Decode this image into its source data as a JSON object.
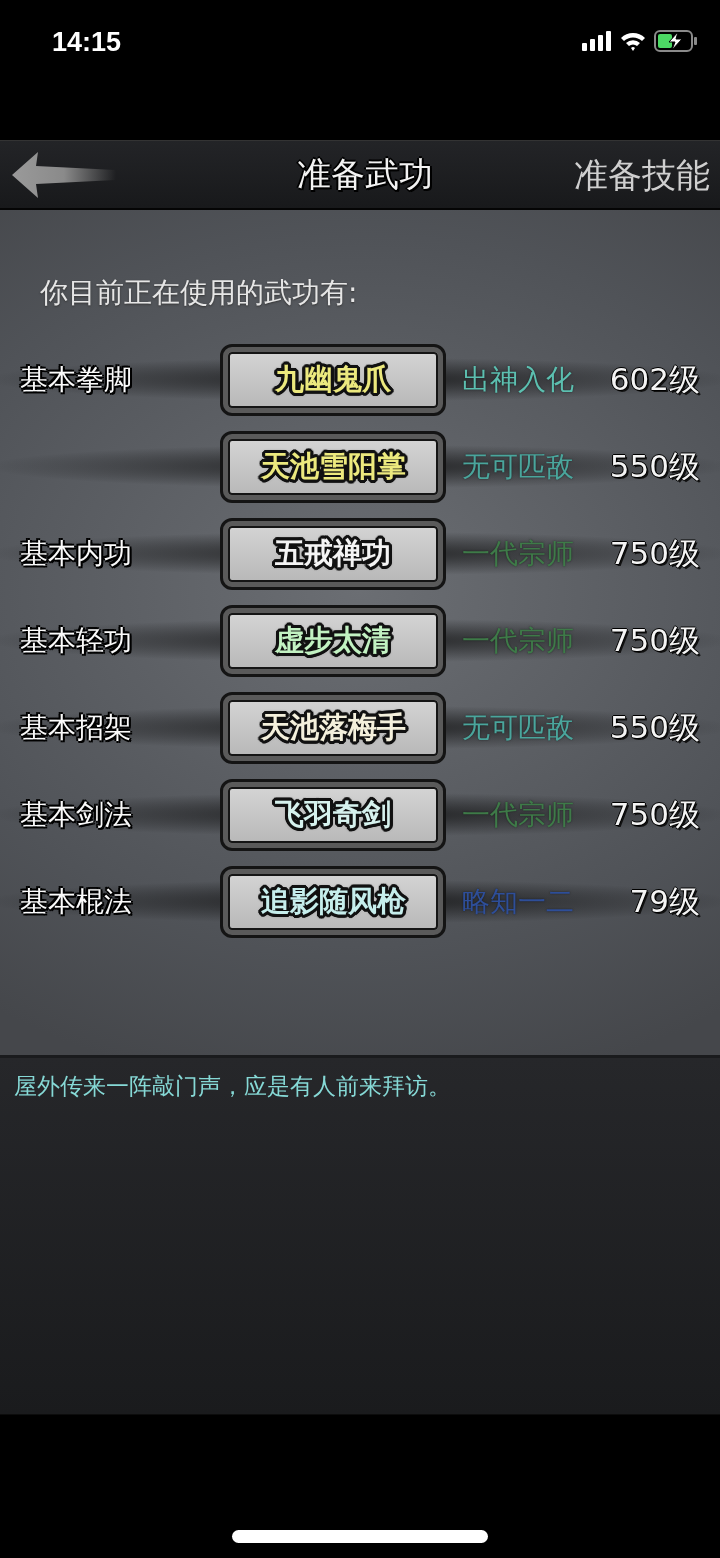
{
  "status_bar": {
    "time": "14:15"
  },
  "header": {
    "title": "准备武功",
    "switch_button": "准备技能"
  },
  "panel": {
    "heading": "你目前正在使用的武功有:",
    "rows": [
      {
        "category": "基本拳脚",
        "skill": {
          "name": "九幽鬼爪",
          "color": "#ece97e"
        },
        "rank": {
          "text": "出神入化",
          "color": "#5cbfb0"
        },
        "grade": "602级"
      },
      {
        "skill": {
          "name": "天池雪阳掌",
          "color": "#ece97e"
        },
        "rank": {
          "text": "无可匹敌",
          "color": "#4aa59c"
        },
        "grade": "550级"
      },
      {
        "category": "基本内功",
        "skill": {
          "name": "五戒禅功",
          "color": "#f4f4f4"
        },
        "rank": {
          "text": "一代宗师",
          "color": "#3e7a48"
        },
        "grade": "750级"
      },
      {
        "category": "基本轻功",
        "skill": {
          "name": "虚步太清",
          "color": "#c2f2c2"
        },
        "rank": {
          "text": "一代宗师",
          "color": "#3e7a48"
        },
        "grade": "750级"
      },
      {
        "category": "基本招架",
        "skill": {
          "name": "天池落梅手",
          "color": "#f4f0dc"
        },
        "rank": {
          "text": "无可匹敌",
          "color": "#4aa59c"
        },
        "grade": "550级"
      },
      {
        "category": "基本剑法",
        "skill": {
          "name": "飞羽奇剑",
          "color": "#d6f2ee"
        },
        "rank": {
          "text": "一代宗师",
          "color": "#3e7a48"
        },
        "grade": "750级"
      },
      {
        "category": "基本棍法",
        "skill": {
          "name": "追影随风枪",
          "color": "#c6eeec"
        },
        "rank": {
          "text": "略知一二",
          "color": "#2e4e98"
        },
        "grade": "79级"
      }
    ]
  },
  "message": "屋外传来一阵敲门声，应是有人前来拜访。"
}
